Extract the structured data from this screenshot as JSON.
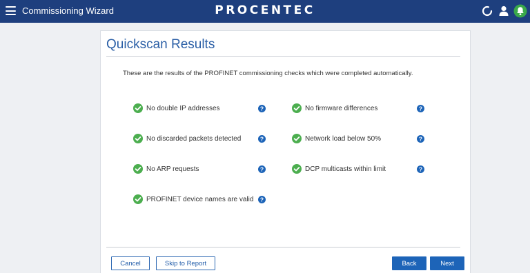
{
  "header": {
    "menu_icon": "hamburger-menu-icon",
    "app_title": "Commissioning Wizard",
    "brand": "PROCENTEC",
    "icons": [
      "progress-spinner-icon",
      "user-icon",
      "notification-bell-icon"
    ],
    "colors": {
      "bar": "#1e3f7e",
      "bell_bg": "#3aa84a"
    }
  },
  "card": {
    "title": "Quickscan Results",
    "intro": "These are the results of the PROFINET commissioning checks which were completed automatically.",
    "checks": [
      {
        "label": "No double IP addresses",
        "status": "passed"
      },
      {
        "label": "No firmware differences",
        "status": "passed"
      },
      {
        "label": "No discarded packets detected",
        "status": "passed"
      },
      {
        "label": "Network load below 50%",
        "status": "passed"
      },
      {
        "label": "No ARP requests",
        "status": "passed"
      },
      {
        "label": "DCP multicasts within limit",
        "status": "passed"
      },
      {
        "label": "PROFINET device names are valid",
        "status": "passed"
      }
    ],
    "check_icon": "check-circle-icon",
    "help_icon": "question-circle-icon",
    "colors": {
      "check": "#4cae4f",
      "help": "#1d64b8",
      "title": "#2b5fa6"
    }
  },
  "footer": {
    "cancel": "Cancel",
    "skip": "Skip to Report",
    "back": "Back",
    "next": "Next"
  }
}
